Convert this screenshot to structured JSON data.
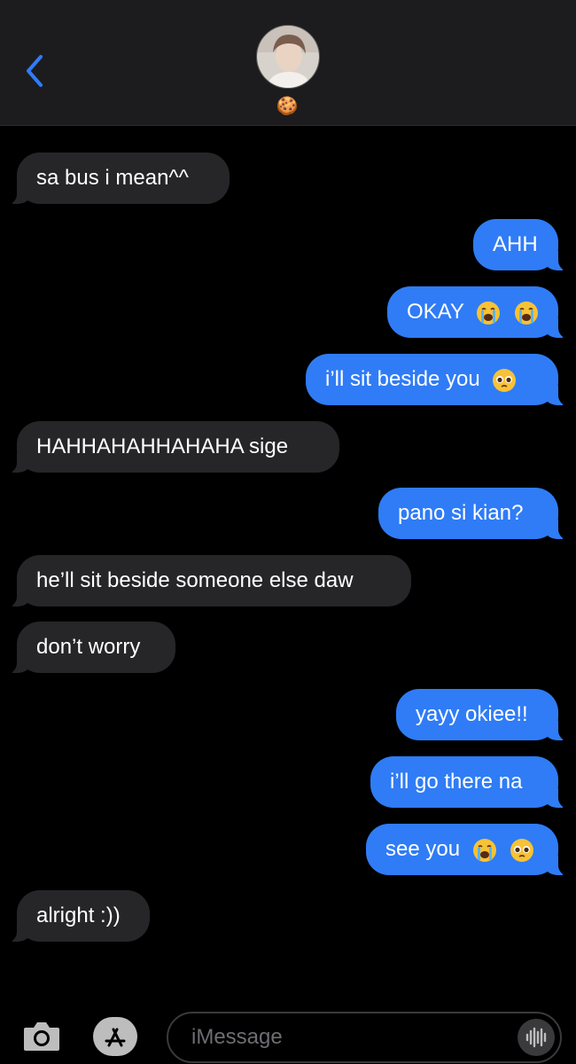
{
  "header": {
    "back_icon": "chevron-left-icon",
    "avatar": "contact-avatar-photo",
    "contact_name_emoji": "🍪"
  },
  "messages": [
    {
      "direction": "incoming",
      "text": "sa bus i mean^^",
      "emojis": []
    },
    {
      "direction": "outgoing",
      "text": "AHH",
      "emojis": []
    },
    {
      "direction": "outgoing",
      "text": "OKAY",
      "emojis": [
        "loudly-crying-face",
        "loudly-crying-face"
      ]
    },
    {
      "direction": "outgoing",
      "text": "i’ll sit beside you",
      "emojis": [
        "pleading-face"
      ]
    },
    {
      "direction": "incoming",
      "text": "HAHHAHAHHAHAHA sige",
      "emojis": []
    },
    {
      "direction": "outgoing",
      "text": "pano si kian?",
      "emojis": []
    },
    {
      "direction": "incoming",
      "text": "he’ll sit beside someone else daw",
      "emojis": []
    },
    {
      "direction": "incoming",
      "text": "don’t worry",
      "emojis": []
    },
    {
      "direction": "outgoing",
      "text": "yayy okiee!!",
      "emojis": []
    },
    {
      "direction": "outgoing",
      "text": "i’ll go there na",
      "emojis": []
    },
    {
      "direction": "outgoing",
      "text": "see you",
      "emojis": [
        "loudly-crying-face",
        "pleading-face"
      ]
    },
    {
      "direction": "incoming",
      "text": "alright :))",
      "emojis": []
    }
  ],
  "composer": {
    "camera_icon": "camera-icon",
    "apps_icon": "app-store-icon",
    "placeholder": "iMessage",
    "audio_icon": "waveform-icon"
  },
  "colors": {
    "outgoing_bubble": "#2f7cf6",
    "incoming_bubble": "#262629",
    "accent": "#2f7cf6",
    "background": "#000000"
  }
}
